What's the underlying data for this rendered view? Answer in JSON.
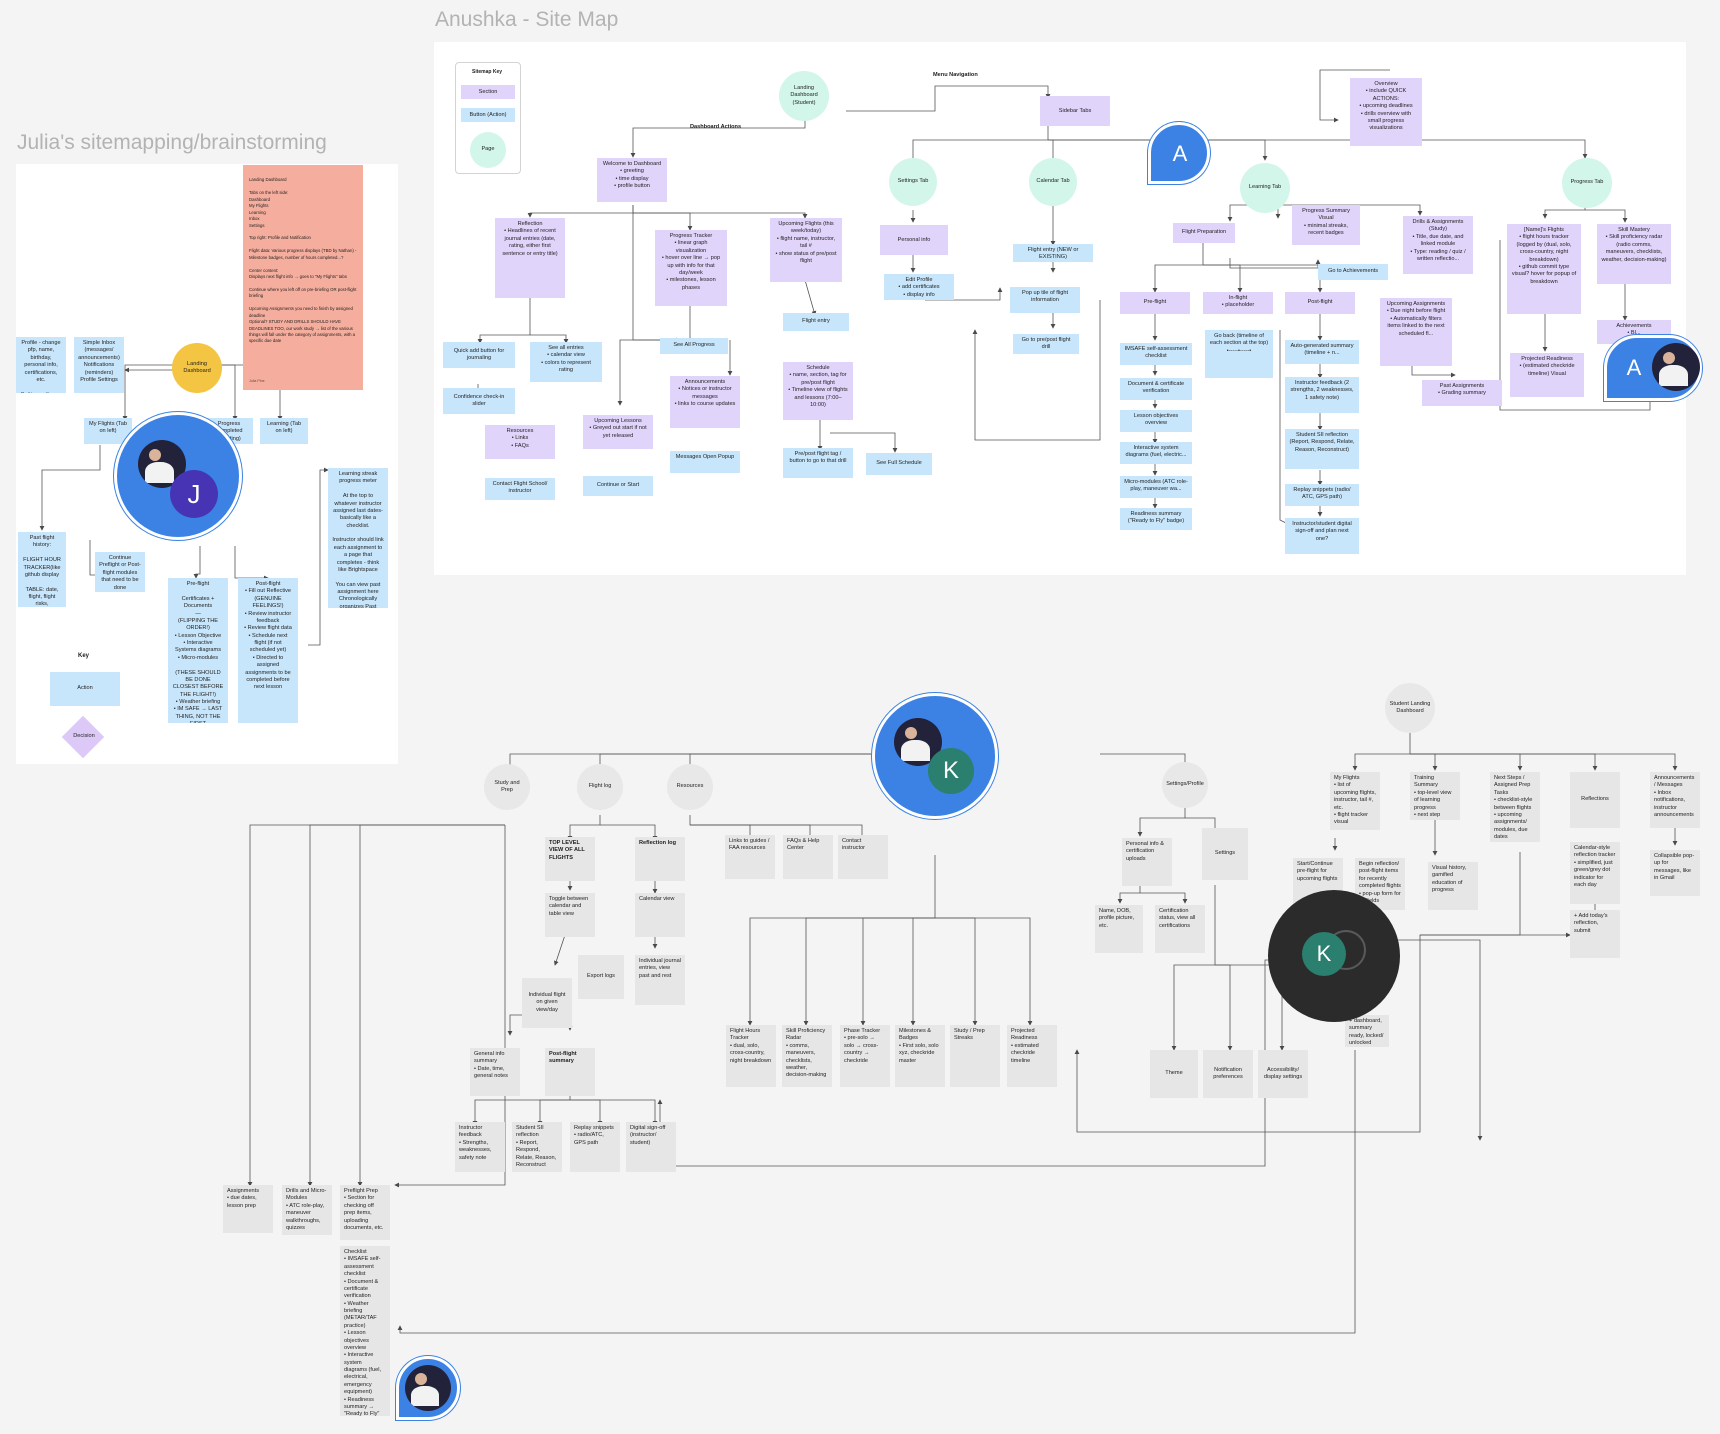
{
  "titles": {
    "julia": "Julia's sitemapping/brainstorming",
    "anushka": "Anushka - Site Map"
  },
  "anushka": {
    "key": {
      "title": "Sitemap Key",
      "section": "Section",
      "button": "Button (Action)",
      "page": "Page"
    },
    "labels": {
      "menu_navigation": "Menu Navigation",
      "dashboard_actions": "Dashboard Actions"
    },
    "pages": {
      "landing": "Landing Dashboard (Student)",
      "settings": "Settings Tab",
      "calendar": "Calendar Tab",
      "learning": "Learning Tab",
      "progress": "Progress Tab"
    },
    "sections": {
      "sidebar": "Sidebar Tabs",
      "overview": "Overview\n• include QUICK ACTIONS:\n• upcoming deadlines\n• drills overview with small progress visualizations",
      "welcome": "Welcome to Dashboard\n• greeting\n• time display\n• profile button",
      "reflection": "Reflection\n• Headlines of recent journal entries (date, rating, either first sentence or entry title)",
      "progress_tracker": "Progress Tracker\n• linear graph visualization\n• hover over line → pop up with info for that day/week\n• milestones, lesson phases",
      "upcoming_flights": "Upcoming Flights (this week/today)\n• flight name, instructor, tail #\n• show status of pre/post flight",
      "personal_info": "Personal info",
      "progress_summary": "Progress Summary Visual\n• minimal streaks, recent badges",
      "drills": "Drills & Assignments (Study)\n• Title, due date, and linked module\n• Type: reading / quiz / written reflectio...",
      "named_flights": "[Name]'s Flights\n• flight hours tracker (logged by (dual, solo, cross-country, night breakdown)\n• github commit type visual? hover for popup of breakdown",
      "skill_mastery": "Skill Mastery\n• Skill proficiency radar (radio comms, maneuvers, checklists, weather, decision-making)",
      "flight_prep": "Flight Preparation",
      "pre_flight": "Pre-flight",
      "in_flight": "In-flight\n• placeholder",
      "post_flight": "Post-flight",
      "upcoming_assign": "Upcoming Assignments\n• Due night before flight\n• Automatically filters items linked to the next scheduled fl...",
      "resources": "Resources\n• Links\n• FAQs",
      "upcoming_lessons": "Upcoming Lessons\n• Greyed out start if not yet released",
      "announcements": "Announcements\n• Notices or instructor messages\n• links to course updates",
      "schedule": "Schedule\n• name, section, tag for pre/post flight\n• Timeline view of flights and lessons (7:00–10:00)",
      "projected": "Projected Readiness\n• (estimated checkride timeline) Visual",
      "past_assign": "Past Assignments\n• Grading summary",
      "achievements": "Achievements\n• Bl..."
    },
    "buttons": {
      "edit_profile": "Edit Profile\n• add certificates\n• display info",
      "flight_entry_new": "Flight entry (NEW or EXISTING)",
      "popup_tile": "Pop up tile of flight information",
      "go_prepost": "Go to pre/post flight drill",
      "go_achievements": "Go to Achievements",
      "flight_entry": "Flight entry",
      "see_all": "See All Progress",
      "quick_add": "Quick add button for journaling",
      "see_entries": "See all entries\n• calendar view\n• colors to represent rating",
      "confidence": "Confidence check-in slider",
      "contact": "Contact Flight School/ instructor",
      "continue": "Continue or Start",
      "messages": "Messages Open Popup",
      "prepost_tag": "Pre/post flight tag / button to go to that drill",
      "see_full": "See Full Schedule",
      "imsafe": "IMSAFE self-assessment checklist",
      "document": "Document & certificate verification",
      "lesson_obj": "Lesson objectives overview",
      "interactive": "Interactive system diagrams (fuel, electric...",
      "micro": "Micro-modules (ATC role-play, maneuver wa...",
      "readiness": "Readiness summary (\"Ready to Fly\" badge)",
      "go_back": "Go back (timeline of each section at the top)\n•-----•-----•",
      "auto_gen": "Auto-generated summary (timeline + n...",
      "instr_fb": "Instructor feedback (2 strengths, 2 weaknesses, 1 safety note)",
      "student_si": "Student SII reflection (Report, Respond, Relate, Reason, Reconstruct)",
      "replay": "Replay snippets (radio/ ATC, GPS path)",
      "signoff": "Instructor/student digital sign-off and plan next one?"
    }
  },
  "julia": {
    "sticky": "Landing Dashboard\n\nTabs on the left side:\nDashboard\nMy Flights\nLearning\nInbox\nSettings\n\nTop right: Profile and Notification\n\nFlight data: Various progress displays (TBD by Nathan) - Milestone badges, number of hours completed...?\n\nCenter content:\nDisplays next flight info → goes to \"My Flights\" tabs\n\nContinue where you left off on pre-briefing OR post-flight briefing\n\nUpcoming Assignments you need to finish by assigned deadline\nOptional? STUDY AND DRILLS SHOULD HAVE DEADLINES TOO, our work study → list of the various things will fall under the category of assignments, with a specific due date",
    "sticky_author": "Julia Pine",
    "landing": "Landing Dashboard",
    "profile": "Profile - change pfp, name, birthday, personal info, certifications, etc.\n\nSettings - theme pref, notifs, etc.",
    "inbox": "Simple Inbox (messages/ announcements) Notifications (reminders) Profile Settings",
    "my_flights": "My Flights (Tab on left)",
    "progress_completed": "Progress Completed (Grading)",
    "learning_tab": "Learning (Tab on left)",
    "flight_history": "Past flight history:\n\nFLIGHT HOUR TRACKER(like github display\n\nTABLE: date, flight, flight risks, evaluations, reflections",
    "continue_preflight": "Continue Preflight or Post-flight modules that need to be done",
    "learning_streak": "Learning streak progress meter\n\nAt the top to whatever instructor assigned last dates- basically like a checklist.\n\nInstructor should link each assignment to a page that completes - think like Brightspace\n\nYou can view past assignment here Chronologically organizes Past modules, Study materials Assignments, Drills, et...",
    "preflight": "Pre-flight\n\nCertificates + Documents\n—\n(FLIPPING THE ORDER!)\n• Lesson Objective\n• Interactive Systems diagrams\n• Micro-modules\n\n(THESE SHOULD BE DONE CLOSEST BEFORE THE FLIGHT!)\n• Weather briefing\n• IM SAFE → LAST THING, NOT THE FIRST",
    "postflight": "Post-flight\n• Fill out Reflective (GENUINE FEELINGS!)\n• Review instructor feedback\n• Review flight data\n• Schedule next flight (if not scheduled yet)\n• Directed to assigned assignments to be completed before next lesson",
    "key_title": "Key",
    "key_action": "Action",
    "key_decision": "Decision"
  },
  "grey": {
    "student_landing": "Student Landing Dashboard",
    "study_prep": "Study and Prep",
    "flight_log": "Flight log",
    "resources": "Resources",
    "settings_profile": "Settings/Profile",
    "top_level": "TOP LEVEL VIEW OF ALL FLIGHTS",
    "reflection_log": "Reflection log",
    "toggle": "Toggle between calendar and table view",
    "calendar_view": "Calendar view",
    "export_logs": "Export logs",
    "individual": "Individual journal entries, view past and rest",
    "individual_flight": "Individual flight on given view/day",
    "general_info": "General info summary\n• Date, time, general notes",
    "postflight_summary": "Post-flight summary",
    "instr_fb": "Instructor feedback\n• Strengths, weaknesses, safety note",
    "student_si": "Student SII reflection\n• Report, Respond, Relate, Reason, Reconstruct",
    "replay": "Replay snippets\n• radio/ATC, GPS path",
    "signoff": "Digital sign-off (instructor/ student)",
    "links_guides": "Links to guides / FAA resources",
    "faqs": "FAQs & Help Center",
    "contact": "Contact instructor",
    "flight_hours": "Flight Hours Tracker\n• dual, solo, cross-country, night breakdown",
    "skill_radar": "Skill Proficiency Radar\n• comms, maneuvers, checklists, weather, decision-making",
    "phase_tracker": "Phase Tracker\n• pre-solo → solo → cross-country → checkride",
    "milestones": "Milestones & Badges\n• First solo, solo xyz, checkride master",
    "study_streaks": "Study / Prep Streaks",
    "projected": "Projected Readiness\n• estimated checkride timeline",
    "personal_info": "Personal info & certification uploads",
    "settings": "Settings",
    "name_dob": "Name, DOB, profile picture, etc.",
    "cert_status": "Certification status, view all certifications",
    "theme": "Theme",
    "notif": "Notification preferences",
    "access": "Accessibility/ display settings",
    "my_flights": "My Flights\n• list of upcoming flights, instructor, tail #, etc.\n• flight tracker visual",
    "training_summary": "Training Summary\n• top-level view of learning progress\n• next step",
    "next_steps": "Next Steps / Assigned Prep Tasks\n• checklist-style between flights\n• upcoming assignments/ modules, due dates",
    "reflections": "Reflections",
    "announcements": "Announcements / Messages\n• Inbox notifications, instructor announcements",
    "start_continue": "Start/Continue pre-flight for upcoming flights",
    "begin_reflect": "Begin reflection/ post-flight items for recently completed flights\n• pop-up form for all fields",
    "visual_history": "Visual history, gamified education of progress",
    "calendar_style": "Calendar-style reflection tracker\n• simplified, just green/grey dot indicator for each day",
    "collapsible": "Collapsible pop-up for messages, like in Gmail",
    "add_today": "+ Add today's reflection, submit",
    "dark_note": "+ dashboard, summary ready, locked/ unlocked",
    "assignments": "Assignments\n• due dates, lesson prep",
    "drills_micro": "Drills and Micro-Modules\n• ATC role-play, maneuver walkthroughs, quizzes",
    "preflight_prep": "Preflight Prep\n• Section for checking off prep items, uploading documents, etc.",
    "checklist": "Checklist\n• IMSAFE self-assessment checklist\n• Document & certificate verification\n• Weather briefing (METAR/TAF practice)\n• Lesson objectives overview\n• Interactive system diagrams (fuel, electrical, emergency equipment)\n• Readiness summary → \"Ready to Fly\" badge"
  },
  "cursors": {
    "a1": "A",
    "a2": "A",
    "j": "J",
    "k1": "K",
    "k2": "K"
  },
  "colors": {
    "section": "#e1d4fb",
    "button": "#c8e6fb",
    "page": "#d2f6ea",
    "sticky": "#f5ae9e",
    "cursor_blue": "#3b82e4"
  }
}
